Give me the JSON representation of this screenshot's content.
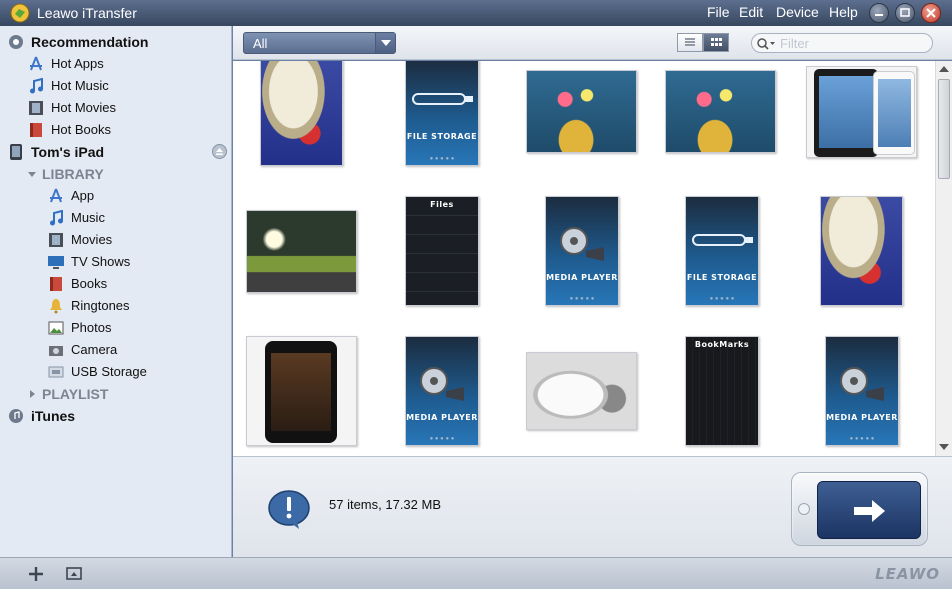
{
  "window": {
    "title": "Leawo iTransfer",
    "menus": [
      "File",
      "Edit",
      "Device",
      "Help"
    ]
  },
  "sidebar": {
    "recommendation": "Recommendation",
    "hot_items": [
      "Hot Apps",
      "Hot Music",
      "Hot Movies",
      "Hot Books"
    ],
    "device": "Tom's iPad",
    "library": "LIBRARY",
    "library_items": [
      "App",
      "Music",
      "Movies",
      "TV Shows",
      "Books",
      "Ringtones",
      "Photos",
      "Camera",
      "USB Storage"
    ],
    "playlist": "PLAYLIST",
    "itunes": "iTunes"
  },
  "toolbar": {
    "filter_select": "All",
    "search_placeholder": "Filter",
    "view_mode": "grid"
  },
  "grid": {
    "captions": {
      "file_storage": "FILE STORAGE",
      "media_player": "MEDIA PLAYER",
      "files_header": "Files",
      "bookmarks_header": "BookMarks"
    }
  },
  "status": {
    "summary": "57 items, 17.32 MB"
  },
  "brand": "LEAWO",
  "colors": {
    "titlebar": "#37475f",
    "sidebar_bg": "#e4eaf3",
    "select_bg": "#5b6e8f",
    "transfer_button": "#1b3463",
    "close_button": "#c0392b"
  }
}
